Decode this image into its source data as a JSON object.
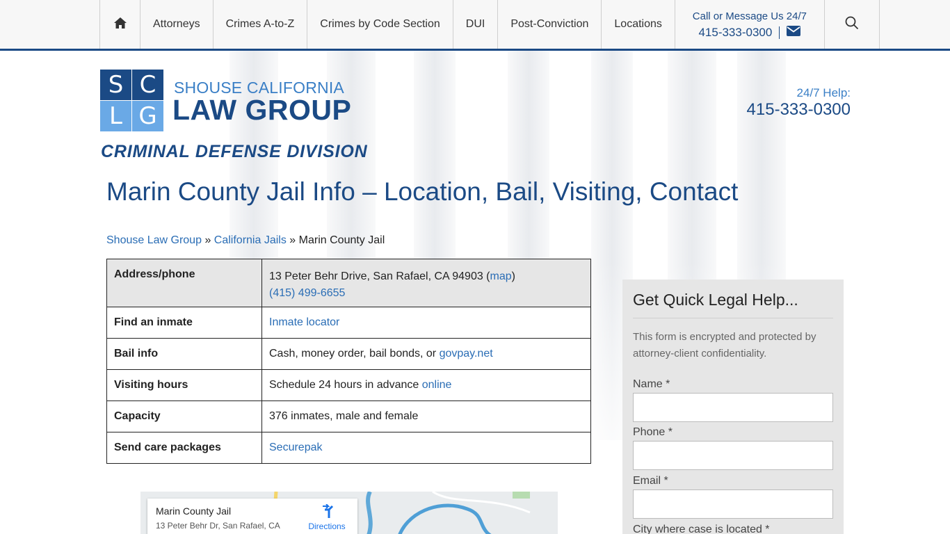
{
  "nav": {
    "items": [
      "Attorneys",
      "Crimes A-to-Z",
      "Crimes by Code Section",
      "DUI",
      "Post-Conviction",
      "Locations"
    ],
    "call_label": "Call or Message Us 24/7",
    "call_phone": "415-333-0300",
    "icons": [
      "home-icon",
      "envelope-icon",
      "search-icon"
    ]
  },
  "logo": {
    "letters": [
      "S",
      "C",
      "L",
      "G"
    ],
    "top": "SHOUSE CALIFORNIA",
    "main": "LAW GROUP",
    "division": "CRIMINAL DEFENSE DIVISION"
  },
  "help": {
    "label": "24/7 Help:",
    "phone": "415-333-0300"
  },
  "page": {
    "title": "Marin County Jail Info – Location, Bail, Visiting, Contact"
  },
  "breadcrumb": {
    "home": "Shouse Law Group",
    "sep": "»",
    "section": "California Jails",
    "current": "Marin County Jail"
  },
  "table": {
    "address_label": "Address/phone",
    "address_text": "13 Peter Behr Drive, San Rafael, CA 94903 (",
    "address_link": "map",
    "address_close": ")",
    "phone": "(415) 499-6655",
    "inmate_label": "Find an inmate",
    "inmate_link": "Inmate locator",
    "bail_label": "Bail info",
    "bail_text": "Cash, money order, bail bonds, or ",
    "bail_link": "govpay.net",
    "visit_label": "Visiting hours",
    "visit_text": "Schedule 24 hours in advance ",
    "visit_link": "online",
    "capacity_label": "Capacity",
    "capacity_text": "376 inmates, male and female",
    "packages_label": "Send care packages",
    "packages_link": "Securepak"
  },
  "map": {
    "title": "Marin County Jail",
    "address": "13 Peter Behr Dr, San Rafael, CA",
    "directions": "Directions"
  },
  "form": {
    "title": "Get Quick Legal Help...",
    "note": "This form is encrypted and protected by attorney-client confidentiality.",
    "name_label": "Name *",
    "phone_label": "Phone *",
    "email_label": "Email *",
    "city_label": "City where case is located *"
  },
  "colors": {
    "brand_dark": "#1b4a85",
    "brand_light": "#6aa9e6",
    "link": "#2a6db5"
  }
}
